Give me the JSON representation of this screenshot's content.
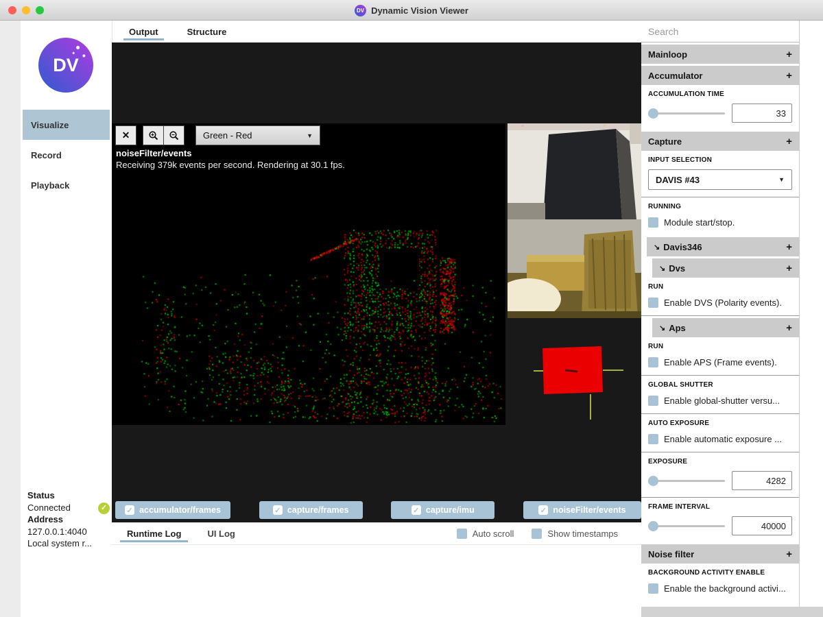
{
  "window": {
    "title": "Dynamic Vision Viewer",
    "logo_text": "DV"
  },
  "glyphs": {
    "close": "✕",
    "check": "✓",
    "plus": "+",
    "caret": "▼",
    "arrow": "↘"
  },
  "colors": {
    "accent": "#a9c3d6",
    "tab_underline": "#8fb6cc",
    "event_green": "#00d400",
    "event_red": "#e10000"
  },
  "sidebar": {
    "logo_text": "DV",
    "nav": [
      {
        "label": "Visualize"
      },
      {
        "label": "Record"
      },
      {
        "label": "Playback"
      }
    ],
    "status": {
      "title": "Status",
      "value": "Connected",
      "address_title": "Address",
      "address_line1": "127.0.0.1:4040",
      "address_line2": "Local system r..."
    }
  },
  "main": {
    "tabs": [
      {
        "label": "Output"
      },
      {
        "label": "Structure"
      }
    ],
    "viewer": {
      "colormap": "Green - Red",
      "stream_name": "noiseFilter/events",
      "stats": "Receiving 379k events per second.  Rendering at 30.1 fps."
    },
    "streams": [
      {
        "label": "accumulator/frames"
      },
      {
        "label": "capture/frames"
      },
      {
        "label": "capture/imu"
      },
      {
        "label": "noiseFilter/events"
      }
    ],
    "log": {
      "tabs": [
        {
          "label": "Runtime Log"
        },
        {
          "label": "UI Log"
        }
      ],
      "auto_scroll": "Auto scroll",
      "show_timestamps": "Show timestamps"
    }
  },
  "panel": {
    "search_placeholder": "Search",
    "mainloop_title": "Mainloop",
    "accumulator_title": "Accumulator",
    "accumulation_time_label": "ACCUMULATION TIME",
    "accumulation_time_value": "33",
    "capture_title": "Capture",
    "input_selection_label": "INPUT SELECTION",
    "input_selection_value": "DAVIS #43",
    "running_label": "RUNNING",
    "running_text": "Module start/stop.",
    "davis346_title": "Davis346",
    "dvs_title": "Dvs",
    "dvs_run_label": "RUN",
    "dvs_run_text": "Enable DVS (Polarity events).",
    "aps_title": "Aps",
    "aps_run_label": "RUN",
    "aps_run_text": "Enable APS (Frame events).",
    "global_shutter_label": "GLOBAL SHUTTER",
    "global_shutter_text": "Enable global-shutter versu...",
    "auto_exposure_label": "AUTO EXPOSURE",
    "auto_exposure_text": "Enable automatic exposure ...",
    "exposure_label": "EXPOSURE",
    "exposure_value": "4282",
    "frame_interval_label": "FRAME INTERVAL",
    "frame_interval_value": "40000",
    "noise_filter_title": "Noise filter",
    "background_activity_label": "BACKGROUND ACTIVITY ENABLE",
    "background_activity_text": "Enable the background activi..."
  }
}
